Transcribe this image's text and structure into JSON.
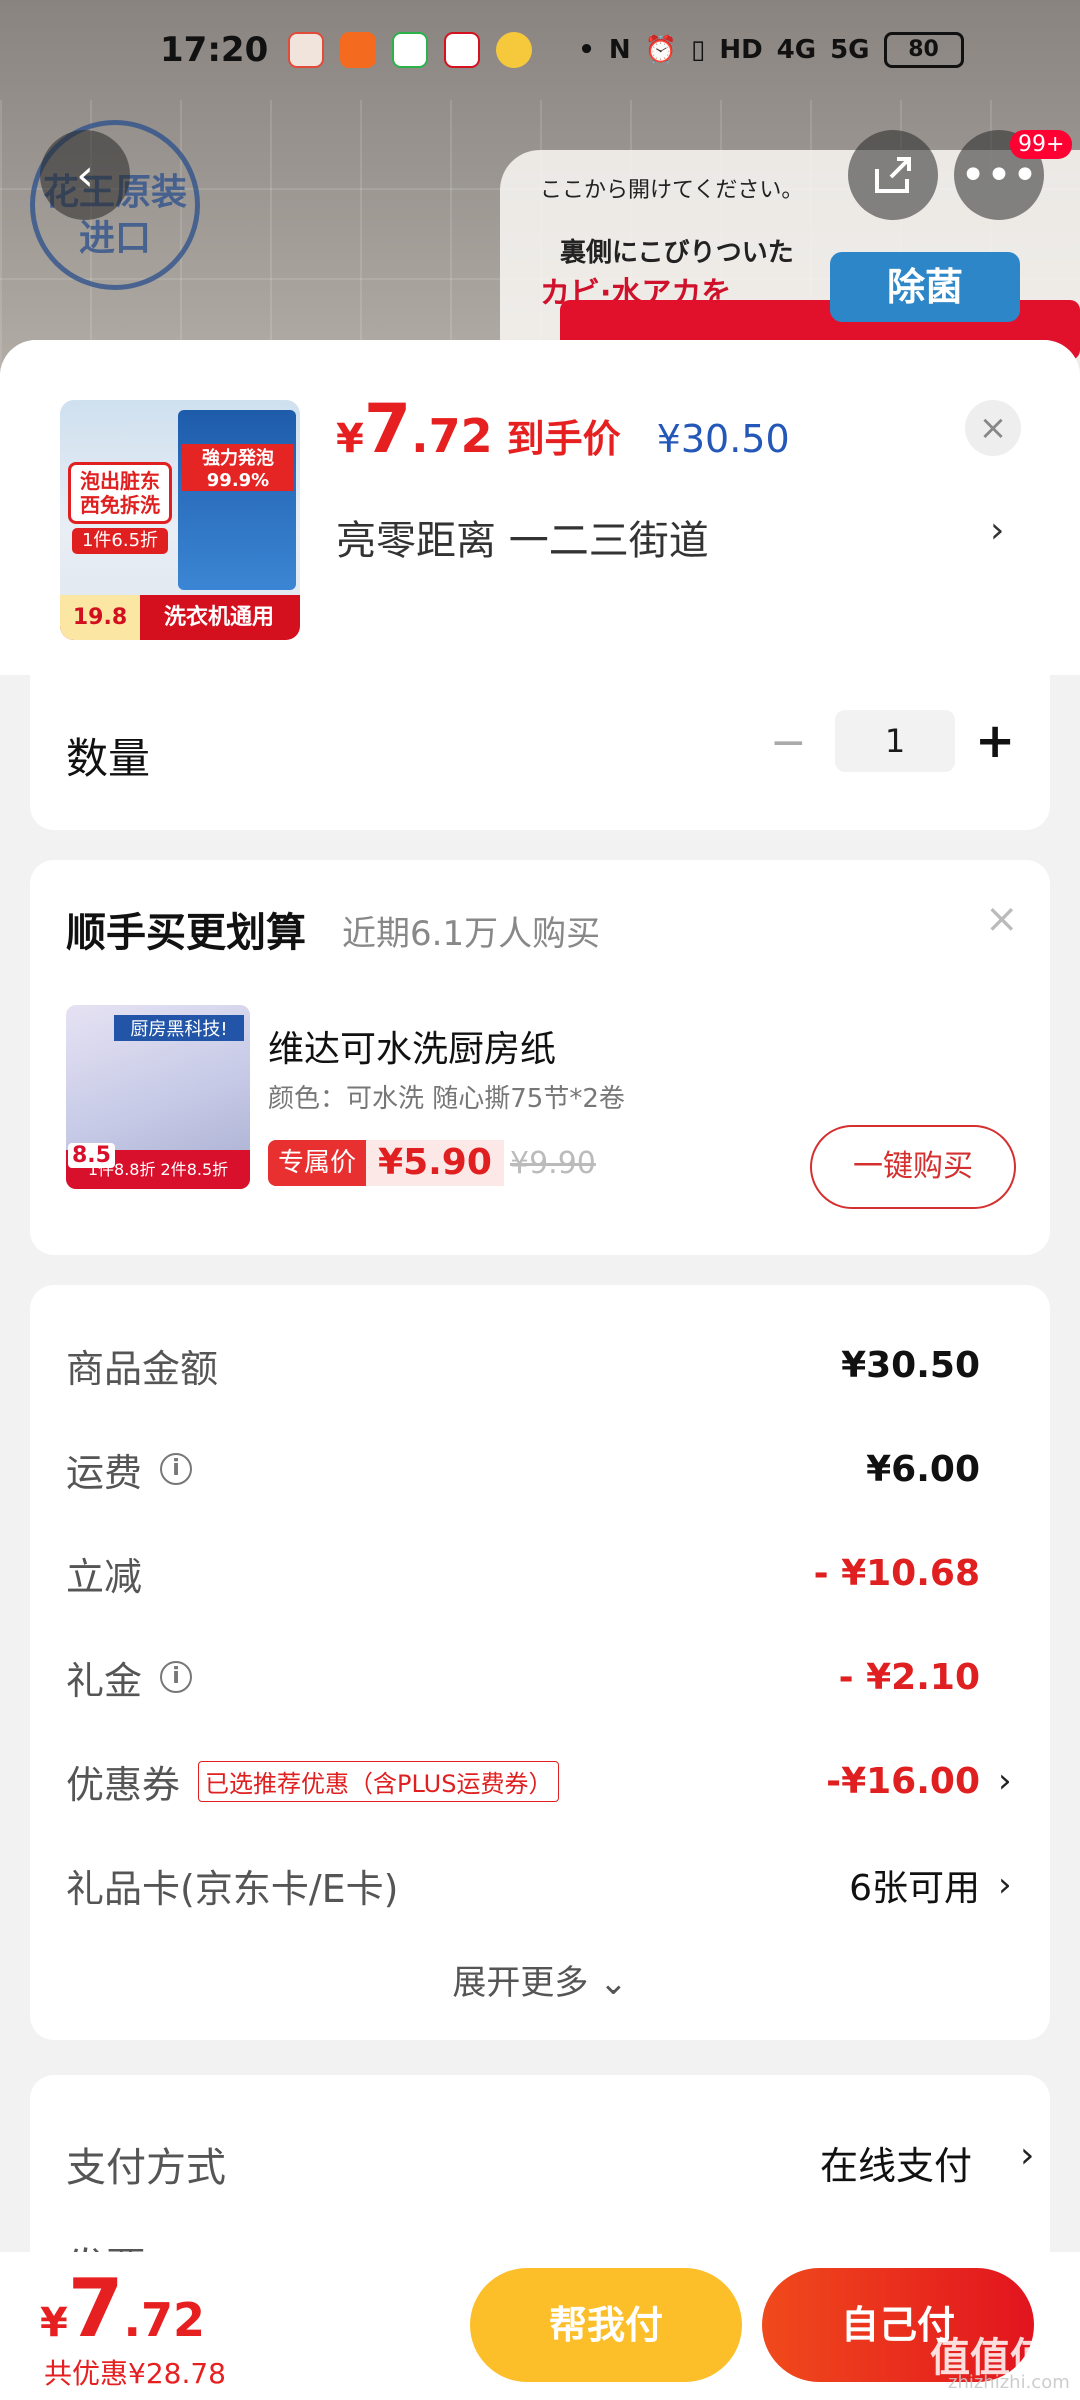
{
  "status_bar": {
    "time": "17:20",
    "network": "4G",
    "network2": "5G",
    "hd": "HD",
    "battery": "80"
  },
  "background": {
    "badge_line1": "花王原装",
    "badge_line2": "进口",
    "jp_line1": "ここから開けてください。",
    "jp_line2": "裏側にこびりついた",
    "jp_line3": "カビ·水アカを",
    "ribbon": "除菌",
    "more_badge": "99+"
  },
  "product": {
    "price_yen": "¥",
    "price_int": "7",
    "price_dec": ".72",
    "price_label": "到手价",
    "original_price": "¥30.50",
    "address": "亮零距离  一二三街道",
    "thumb_tag": "泡出脏东西免拆洗",
    "thumb_tag2": "1件6.5折",
    "thumb_blue_text": "強力発泡99.9%",
    "thumb_bottom": "洗衣机通用",
    "thumb_price": "19.8"
  },
  "quantity": {
    "label": "数量",
    "value": "1",
    "minus": "−",
    "plus": "+"
  },
  "addon": {
    "title": "顺手买更划算",
    "subtitle": "近期6.1万人购买",
    "img_title": "厨房黑科技!",
    "img_badge": "8.5",
    "img_bottom": "1件8.8折 2件8.5折",
    "name": "维达可水洗厨房纸",
    "spec": "颜色：可水洗 随心撕75节*2卷",
    "tag_label": "专属价",
    "price": "¥5.90",
    "old_price": "¥9.90",
    "button": "一键购买"
  },
  "summary": {
    "rows": [
      {
        "label": "商品金额",
        "value": "¥30.50"
      },
      {
        "label": "运费",
        "value": "¥6.00"
      },
      {
        "label": "立减",
        "value": "- ¥10.68"
      },
      {
        "label": "礼金",
        "value": "- ¥2.10"
      },
      {
        "label": "优惠券",
        "tag": "已选推荐优惠（含PLUS运费券）",
        "value": "-¥16.00"
      },
      {
        "label": "礼品卡(京东卡/E卡)",
        "value": "6张可用"
      }
    ],
    "expand": "展开更多"
  },
  "payment": {
    "label": "支付方式",
    "value": "在线支付",
    "label2": "发票"
  },
  "bottom_bar": {
    "price_yen": "¥",
    "price_int": "7",
    "price_dec": ".72",
    "discount": "共优惠¥28.78",
    "help_pay": "帮我付",
    "self_pay": "自己付"
  },
  "watermark": {
    "text": "值值值",
    "url": "zhizhizhi.com"
  },
  "colors": {
    "accent_red": "#e62020",
    "price_blue": "#2458b8",
    "help_yellow": "#fcbf2a"
  }
}
